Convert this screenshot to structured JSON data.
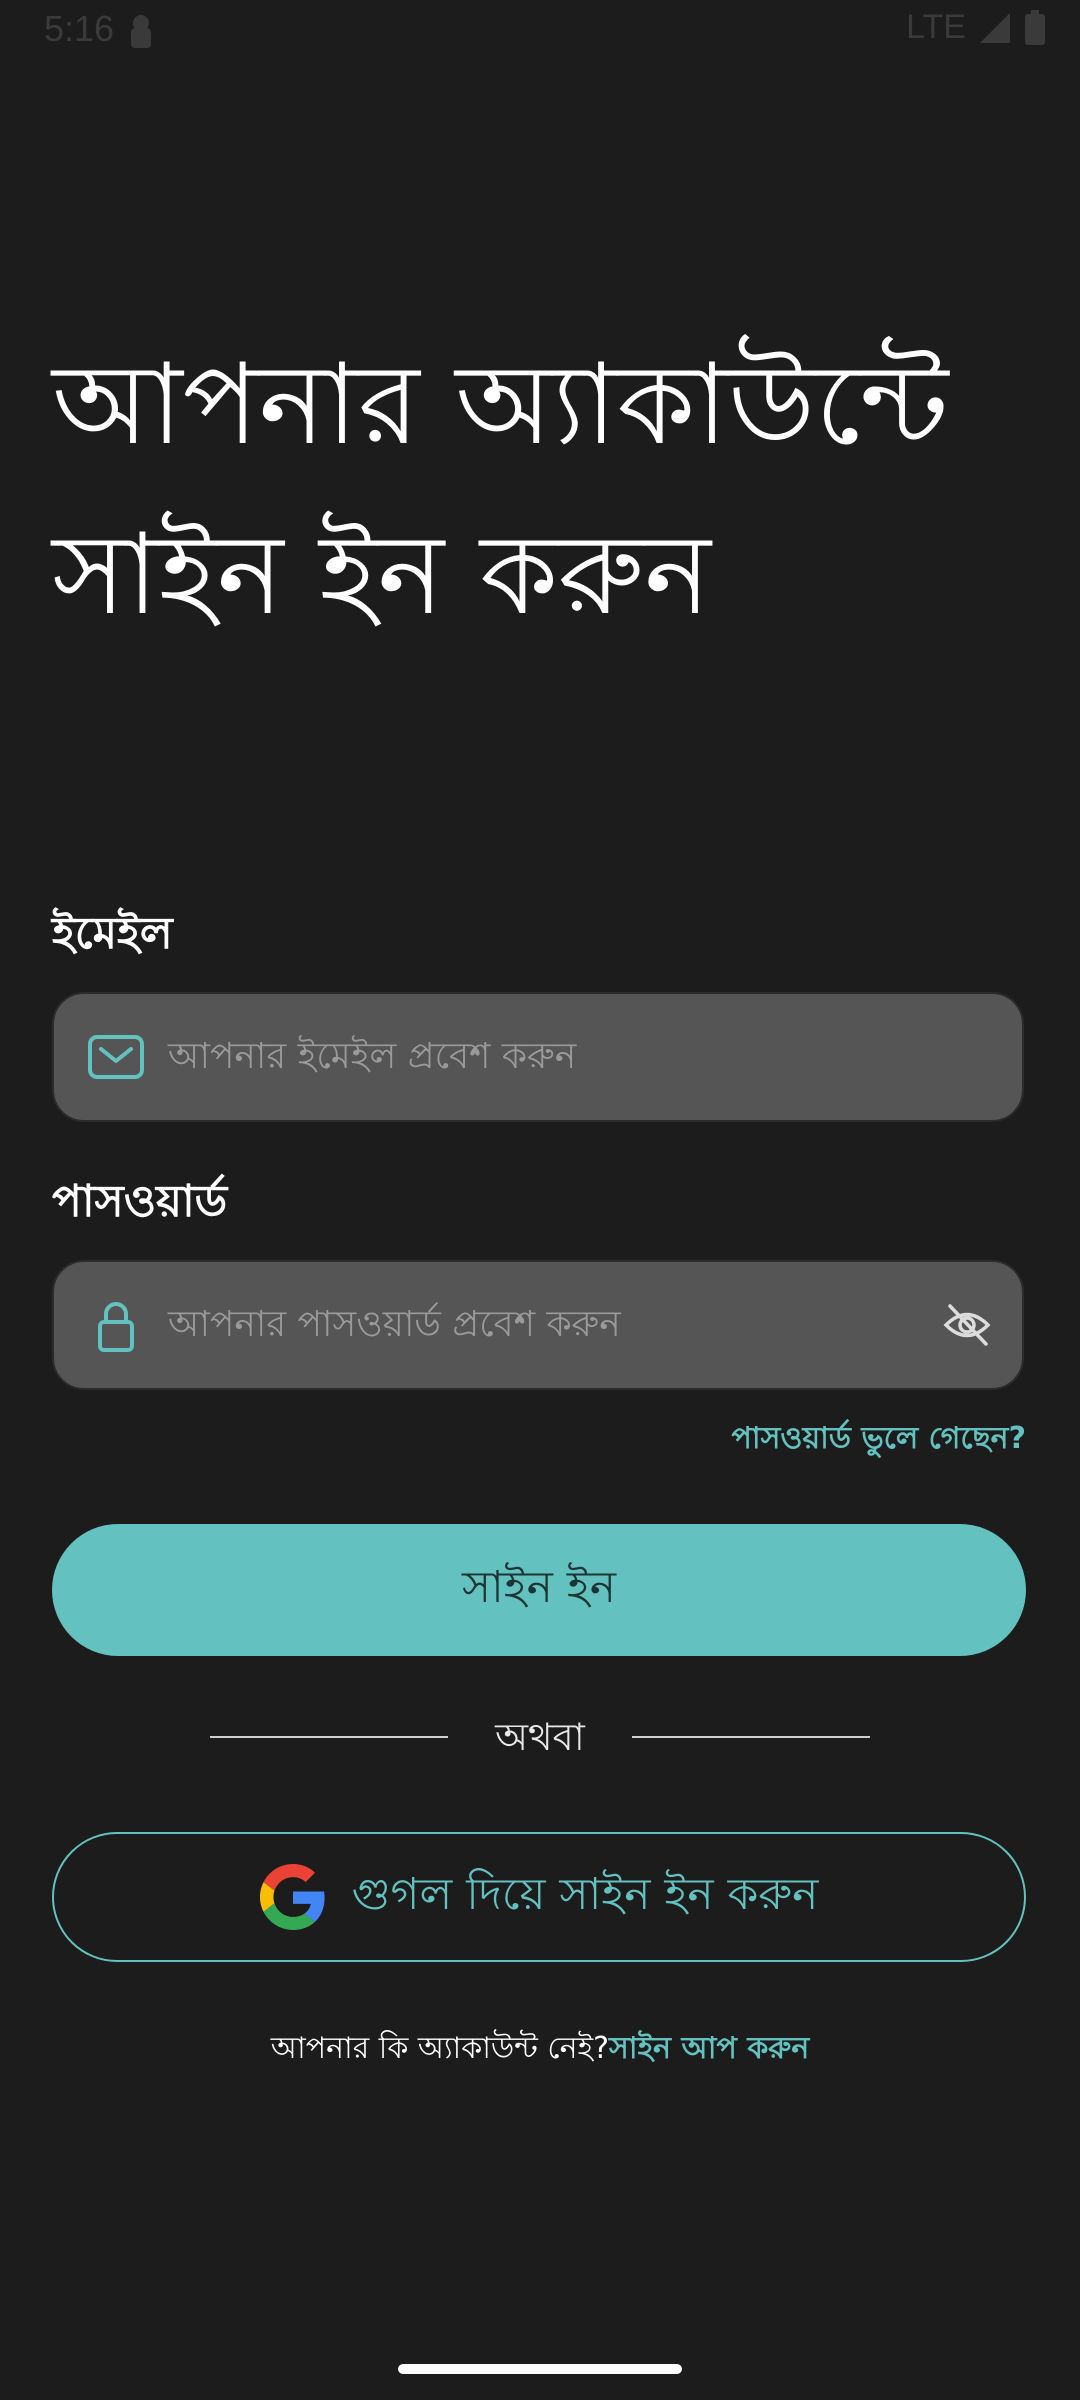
{
  "status_bar": {
    "time": "5:16",
    "network": "LTE",
    "icons": [
      "lock-icon",
      "signal-icon",
      "battery-icon"
    ]
  },
  "title": "আপনার অ্যাকাউন্টে সাইন ইন করুন",
  "email": {
    "label": "ইমেইল",
    "placeholder": "আপনার ইমেইল প্রবেশ করুন",
    "icon": "mail-icon"
  },
  "password": {
    "label": "পাসওয়ার্ড",
    "placeholder": "আপনার পাসওয়ার্ড প্রবেশ করুন",
    "icon": "lock-icon",
    "toggle_icon": "eye-off-icon"
  },
  "forgot_password": "পাসওয়ার্ড ভুলে গেছেন?",
  "sign_in_button": "সাইন ইন",
  "divider_text": "অথবা",
  "google_button": {
    "label": "গুগল দিয়ে সাইন ইন করুন",
    "icon": "google-icon"
  },
  "signup_prompt": {
    "text": "আপনার কি অ্যাকাউন্ট নেই?",
    "link": "সাইন আপ করুন"
  },
  "colors": {
    "background": "#1c1c1c",
    "accent": "#63c1bf",
    "input_bg": "#555555"
  }
}
